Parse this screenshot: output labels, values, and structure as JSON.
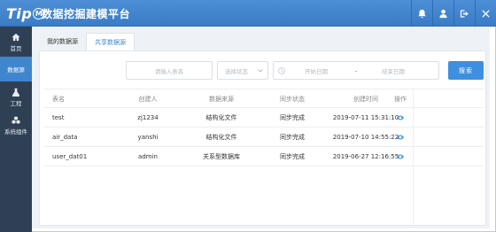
{
  "header": {
    "logo_text": "Tip",
    "logo_badge": "M",
    "app_title": "数据挖掘建模平台",
    "icons": [
      "bell-icon",
      "user-icon",
      "logout-icon",
      "close-icon"
    ]
  },
  "sidebar": {
    "items": [
      {
        "label": "首页",
        "icon": "home-icon"
      },
      {
        "label": "数据源",
        "icon": ""
      },
      {
        "label": "工程",
        "icon": "flask-icon"
      },
      {
        "label": "系统组件",
        "icon": "cubes-icon"
      }
    ]
  },
  "tabs": [
    "我的数据源",
    "共享数据源"
  ],
  "filters": {
    "name_placeholder": "请输入表名",
    "status_placeholder": "选择状态",
    "start_placeholder": "开始日期",
    "date_separator": "-",
    "end_placeholder": "结束日期",
    "search_label": "搜索"
  },
  "table": {
    "headers": [
      "表名",
      "创建人",
      "数据来源",
      "同步状态",
      "创建时间",
      "操作"
    ],
    "rows": [
      {
        "name": "test",
        "creator": "zj1234",
        "source": "结构化文件",
        "status": "同步完成",
        "created": "2019-07-11 15:31:10",
        "action": "view"
      },
      {
        "name": "air_data",
        "creator": "yanshi",
        "source": "结构化文件",
        "status": "同步完成",
        "created": "2019-07-10 14:55:22",
        "action": "view"
      },
      {
        "name": "user_dat01",
        "creator": "admin",
        "source": "关系型数据库",
        "status": "同步完成",
        "created": "2019-06-27 12:16:55",
        "action": "view"
      }
    ]
  },
  "colors": {
    "header": "#4488d2",
    "sidebar": "#2f4055",
    "accent": "#3e8fe0"
  }
}
